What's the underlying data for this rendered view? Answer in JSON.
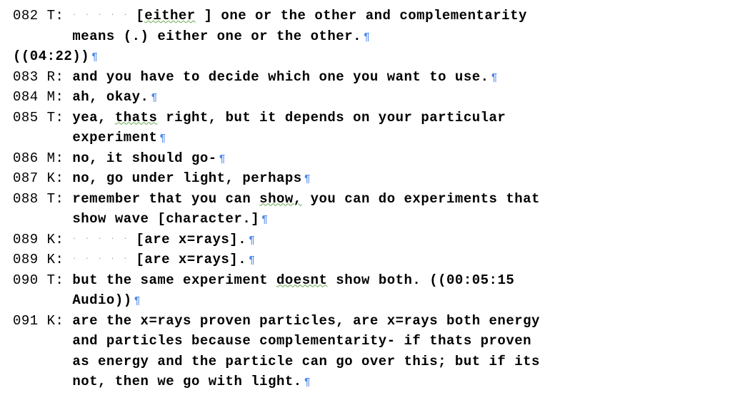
{
  "lines": [
    {
      "num": "082",
      "speaker": "T:",
      "lead_dots": 5,
      "pre": "[",
      "grammar_word": "either",
      "post_grammar_pad": "  ",
      "post": "] one or the other and complementarity",
      "cont": "means (.) either one or the other.",
      "pilcrow_top": false,
      "pilcrow": true
    },
    {
      "timestamp": "((04:22))",
      "pilcrow": true
    },
    {
      "num": "083",
      "speaker": "R:",
      "text": "and you have to decide which one you want to use.",
      "pilcrow": true
    },
    {
      "num": "084",
      "speaker": "M:",
      "text": "ah, okay.",
      "pilcrow": true
    },
    {
      "num": "085",
      "speaker": "T:",
      "pre": "yea, ",
      "grammar_word": "thats",
      "post": " right, but it depends on your particular",
      "cont": "experiment",
      "pilcrow": true
    },
    {
      "num": "086",
      "speaker": "M:",
      "text": "no, it should go-",
      "pilcrow": true
    },
    {
      "num": "087",
      "speaker": "K:",
      "text": "no, go under light, perhaps",
      "pilcrow": true
    },
    {
      "num": "088",
      "speaker": "T:",
      "pre": "remember that you can ",
      "grammar_word": "show,",
      "post": " you can do experiments that",
      "cont": "show wave [character.]",
      "pilcrow": true
    },
    {
      "num": "089",
      "speaker": "K:",
      "lead_dots": 5,
      "text": "[are x=rays].",
      "pilcrow": true
    },
    {
      "num": "089",
      "speaker": "K:",
      "lead_dots": 5,
      "text": "[are x=rays].",
      "pilcrow": true
    },
    {
      "num": "090",
      "speaker": "T:",
      "pre": "but the same experiment ",
      "grammar_word": "doesnt",
      "post": " show both. ((00:05:15",
      "cont": "Audio))",
      "pilcrow": true
    },
    {
      "num": "091",
      "speaker": "K:",
      "multiline": [
        "are the x=rays proven particles, are x=rays both energy",
        "and particles because complementarity- if thats proven",
        "as energy and the particle can go over this; but if its",
        "not, then we go with light."
      ],
      "pilcrow": true
    }
  ],
  "pilcrow_char": "¶",
  "dot_char": "·"
}
